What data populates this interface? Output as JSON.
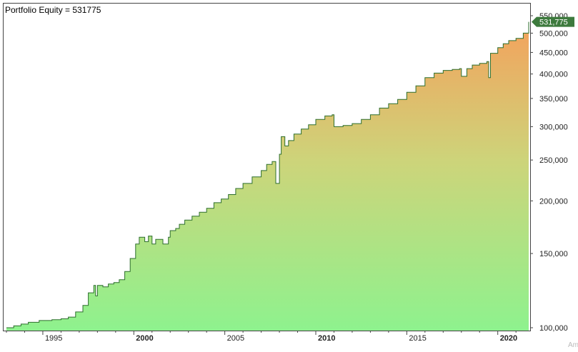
{
  "chart_data": {
    "type": "area",
    "title": "Portfolio Equity = 531775",
    "last_value_label": "531,775",
    "watermark": "Am",
    "scale": "log",
    "ylim": [
      98000,
      560000
    ],
    "xlim": [
      1992.9,
      2021.9
    ],
    "y_ticks": [
      {
        "value": 100000,
        "label": "100,000"
      },
      {
        "value": 150000,
        "label": "150,000"
      },
      {
        "value": 200000,
        "label": "200,000"
      },
      {
        "value": 250000,
        "label": "250,000"
      },
      {
        "value": 300000,
        "label": "300,000"
      },
      {
        "value": 350000,
        "label": "350,000"
      },
      {
        "value": 400000,
        "label": "400,000"
      },
      {
        "value": 450000,
        "label": "450,000"
      },
      {
        "value": 500000,
        "label": "500,000"
      },
      {
        "value": 550000,
        "label": "550,000"
      }
    ],
    "x_ticks": [
      {
        "value": 1995,
        "label": "1995",
        "bold": false
      },
      {
        "value": 2000,
        "label": "2000",
        "bold": true
      },
      {
        "value": 2005,
        "label": "2005",
        "bold": false
      },
      {
        "value": 2010,
        "label": "2010",
        "bold": true
      },
      {
        "value": 2015,
        "label": "2015",
        "bold": false
      },
      {
        "value": 2020,
        "label": "2020",
        "bold": true
      }
    ],
    "minor_x_ticks": [
      1993,
      1994,
      1996,
      1997,
      1998,
      1999,
      2001,
      2002,
      2003,
      2004,
      2006,
      2007,
      2008,
      2009,
      2011,
      2012,
      2013,
      2014,
      2016,
      2017,
      2018,
      2019,
      2021
    ],
    "series": [
      {
        "x": [
          1993.0,
          1993.4,
          1993.8,
          1994.2,
          1994.8,
          1995.5,
          1996.0,
          1996.4,
          1996.8,
          1997.2,
          1997.5,
          1997.8,
          1997.9,
          1998.0,
          1998.3,
          1998.6,
          1998.9,
          1999.2,
          1999.5,
          1999.8,
          2000.1,
          2000.3,
          2000.6,
          2000.8,
          2001.0,
          2001.2,
          2001.6,
          2001.9,
          2002.0,
          2002.3,
          2002.5,
          2002.8,
          2003.2,
          2003.6,
          2004.0,
          2004.4,
          2004.8,
          2005.2,
          2005.6,
          2006.0,
          2006.5,
          2007.0,
          2007.3,
          2007.6,
          2007.8,
          2008.0,
          2008.1,
          2008.3,
          2008.5,
          2008.8,
          2009.2,
          2009.6,
          2010.0,
          2010.5,
          2010.9,
          2011.0,
          2011.5,
          2012.0,
          2012.5,
          2013.0,
          2013.5,
          2014.0,
          2014.5,
          2015.0,
          2015.5,
          2016.0,
          2016.5,
          2017.0,
          2017.5,
          2017.9,
          2018.0,
          2018.3,
          2018.6,
          2019.0,
          2019.4,
          2019.5,
          2019.6,
          2020.0,
          2020.3,
          2020.6,
          2021.0,
          2021.4,
          2021.7
        ],
        "values": [
          100000,
          101000,
          102000,
          103000,
          104000,
          104500,
          105000,
          106000,
          109000,
          113000,
          121000,
          126000,
          119000,
          126000,
          125000,
          127000,
          128000,
          130000,
          136000,
          146000,
          158000,
          164000,
          160000,
          165000,
          158000,
          162000,
          158000,
          164000,
          170000,
          172000,
          176000,
          180000,
          184000,
          188000,
          192000,
          198000,
          202000,
          207000,
          214000,
          220000,
          228000,
          236000,
          244000,
          248000,
          220000,
          258000,
          284000,
          270000,
          278000,
          288000,
          296000,
          303000,
          312000,
          318000,
          320000,
          300000,
          302000,
          305000,
          312000,
          320000,
          332000,
          340000,
          348000,
          362000,
          375000,
          392000,
          402000,
          408000,
          410000,
          412000,
          395000,
          412000,
          420000,
          424000,
          428000,
          392000,
          448000,
          462000,
          472000,
          480000,
          486000,
          500000,
          531775
        ]
      }
    ],
    "colors": {
      "fill_top": "#f4a15c",
      "fill_mid": "#cdd47a",
      "fill_bottom": "#8ef28e",
      "line": "#2c6e2c",
      "last_value_bg": "#3d7a3d",
      "axis": "#444444",
      "background": "#ffffff"
    }
  }
}
